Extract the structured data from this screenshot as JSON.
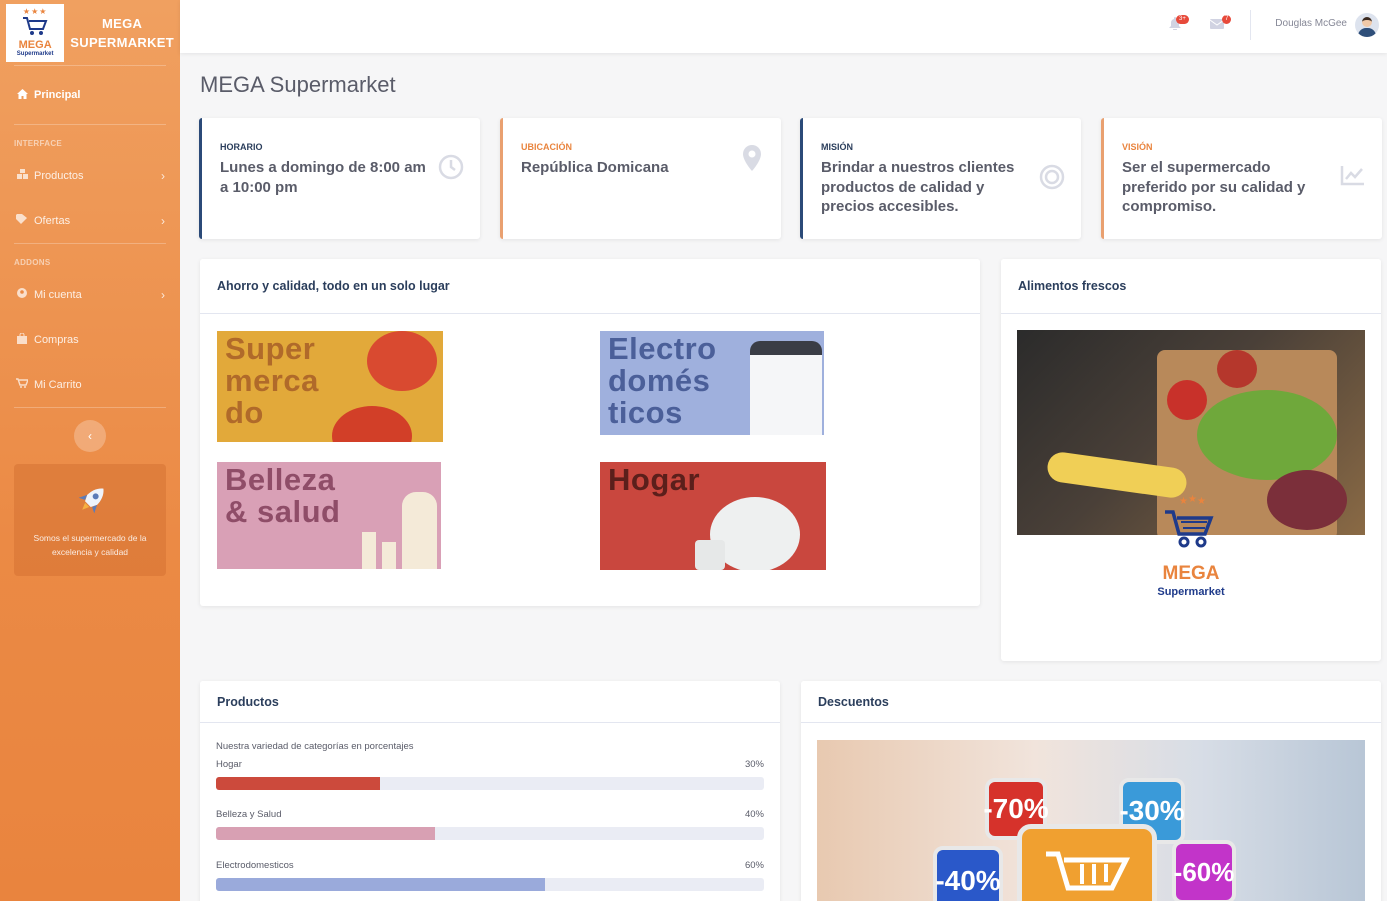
{
  "brand": {
    "name_line1": "MEGA",
    "name_line2": "SUPERMARKET",
    "logo_mega": "MEGA",
    "logo_sub": "Supermarket"
  },
  "sidebar": {
    "active_item": {
      "label": "Principal",
      "icon": "home-icon"
    },
    "headings": [
      "INTERFACE",
      "ADDONS"
    ],
    "items": [
      {
        "label": "Productos",
        "icon": "cubes-icon",
        "has_chevron": true
      },
      {
        "label": "Ofertas",
        "icon": "tag-icon",
        "has_chevron": true
      },
      {
        "label": "Mi cuenta",
        "icon": "user-circle-icon",
        "has_chevron": true
      },
      {
        "label": "Compras",
        "icon": "shopping-bag-icon",
        "has_chevron": false
      },
      {
        "label": "Mi Carrito",
        "icon": "cart-icon",
        "has_chevron": false
      }
    ],
    "promo_text": "Somos el supermercado de la excelencia y calidad"
  },
  "topbar": {
    "alerts_badge": "3+",
    "messages_badge": "7",
    "user_name": "Douglas McGee"
  },
  "page_title": "MEGA Supermarket",
  "info_cards": [
    {
      "label": "Horario",
      "value": "Lunes a domingo de 8:00 am a 10:00 pm",
      "icon": "clock-icon",
      "accent": "primary"
    },
    {
      "label": "Ubicación",
      "value": "República Domicana",
      "icon": "map-marker-icon",
      "accent": "warning"
    },
    {
      "label": "Misión",
      "value": "Brindar a nuestros clientes productos de calidad y precios accesibles.",
      "icon": "bullseye-icon",
      "accent": "primary"
    },
    {
      "label": "Visión",
      "value": "Ser el supermercado preferido por su calidad y compromiso.",
      "icon": "chart-line-icon",
      "accent": "warning"
    }
  ],
  "categories_card": {
    "title": "Ahorro y calidad, todo en un solo lugar",
    "tiles": [
      {
        "lines": [
          "Super",
          "merca",
          "do"
        ],
        "bg": "#e2a93a",
        "fg": "#b06a2a"
      },
      {
        "lines": [
          "Electro",
          "domés",
          "ticos"
        ],
        "bg": "#9fb0dd",
        "fg": "#4b5f99"
      },
      {
        "lines": [
          "Belleza",
          "& salud"
        ],
        "bg": "#d9a0b6",
        "fg": "#8f4d68"
      },
      {
        "lines": [
          "Hogar"
        ],
        "bg": "#c9473e",
        "fg": "#5b1f1b"
      }
    ]
  },
  "fresh_card": {
    "title": "Alimentos frescos",
    "logo_mega": "MEGA",
    "logo_sub": "Supermarket"
  },
  "products_card": {
    "title": "Productos",
    "intro": "Nuestra variedad de categorías en porcentajes",
    "bars": [
      {
        "label": "Hogar",
        "value_label": "30%",
        "fraction": 0.3,
        "color": "#cc4a3c"
      },
      {
        "label": "Belleza y Salud",
        "value_label": "40%",
        "fraction": 0.4,
        "color": "#d8a0b3"
      },
      {
        "label": "Electrodomesticos",
        "value_label": "60%",
        "fraction": 0.6,
        "color": "#9aaadb"
      }
    ]
  },
  "discounts_card": {
    "title": "Descuentos",
    "badges": [
      "-70%",
      "-30%",
      "-40%",
      "-60%"
    ]
  },
  "colors": {
    "sidebar_orange": "#eb8a45",
    "primary_navy": "#2b3e5c",
    "warning_orange": "#e9843e"
  }
}
